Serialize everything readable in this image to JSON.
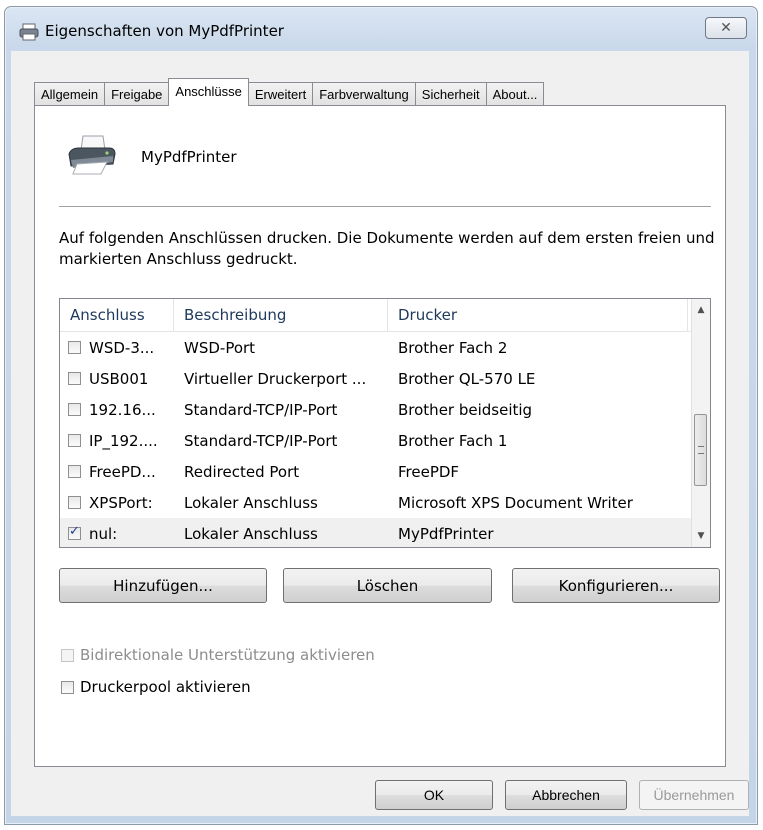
{
  "window": {
    "title": "Eigenschaften von MyPdfPrinter",
    "close_glyph": "✕"
  },
  "tabs": [
    {
      "label": "Allgemein"
    },
    {
      "label": "Freigabe"
    },
    {
      "label": "Anschlüsse",
      "active": true
    },
    {
      "label": "Erweitert"
    },
    {
      "label": "Farbverwaltung"
    },
    {
      "label": "Sicherheit"
    },
    {
      "label": "About..."
    }
  ],
  "printer": {
    "name": "MyPdfPrinter",
    "icon": "printer-icon"
  },
  "description": "Auf folgenden Anschlüssen drucken. Die Dokumente werden auf dem ersten freien und markierten Anschluss gedruckt.",
  "ports": {
    "headers": [
      "Anschluss",
      "Beschreibung",
      "Drucker"
    ],
    "rows": [
      {
        "port": "WSD-3...",
        "description": "WSD-Port",
        "printer": "Brother Fach 2",
        "checked": false
      },
      {
        "port": "USB001",
        "description": "Virtueller Druckerport ...",
        "printer": "Brother QL-570 LE",
        "checked": false
      },
      {
        "port": "192.16...",
        "description": "Standard-TCP/IP-Port",
        "printer": "Brother beidseitig",
        "checked": false
      },
      {
        "port": "IP_192....",
        "description": "Standard-TCP/IP-Port",
        "printer": "Brother Fach 1",
        "checked": false
      },
      {
        "port": "FreePD...",
        "description": "Redirected Port",
        "printer": "FreePDF",
        "checked": false
      },
      {
        "port": "XPSPort:",
        "description": "Lokaler Anschluss",
        "printer": "Microsoft XPS Document Writer",
        "checked": false
      },
      {
        "port": "nul:",
        "description": "Lokaler Anschluss",
        "printer": "MyPdfPrinter",
        "checked": true,
        "selected": true
      }
    ]
  },
  "buttons": {
    "add": "Hinzufügen...",
    "delete": "Löschen",
    "configure": "Konfigurieren..."
  },
  "options": {
    "bidirectional": {
      "label": "Bidirektionale Unterstützung aktivieren",
      "checked": false,
      "enabled": false
    },
    "pool": {
      "label": "Druckerpool aktivieren",
      "checked": false,
      "enabled": true
    }
  },
  "footer": {
    "ok": "OK",
    "cancel": "Abbrechen",
    "apply": "Übernehmen"
  }
}
